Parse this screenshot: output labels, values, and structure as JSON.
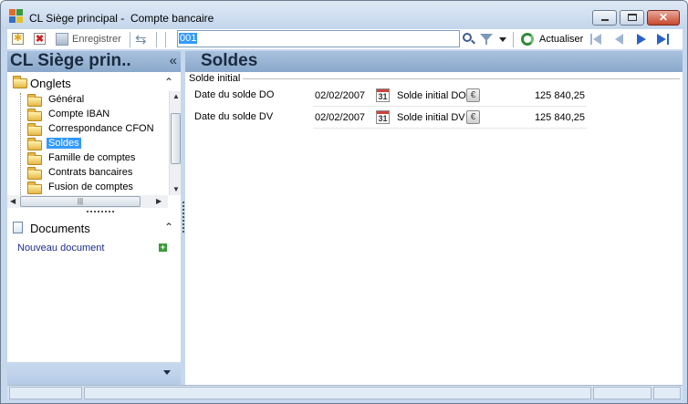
{
  "window": {
    "title": "CL Siège principal -  Compte bancaire"
  },
  "toolbar": {
    "save_label": "Enregistrer",
    "search_value": "001",
    "refresh_label": "Actualiser"
  },
  "sidebar": {
    "title": "CL Siège prin..",
    "collapse_glyph": "«",
    "onglets_header": "Onglets",
    "tree_items": [
      {
        "label": "Général",
        "selected": false
      },
      {
        "label": "Compte IBAN",
        "selected": false
      },
      {
        "label": "Correspondance CFON",
        "selected": false
      },
      {
        "label": "Soldes",
        "selected": true
      },
      {
        "label": "Famille de comptes",
        "selected": false
      },
      {
        "label": "Contrats bancaires",
        "selected": false
      },
      {
        "label": "Fusion de comptes",
        "selected": false
      }
    ],
    "documents_header": "Documents",
    "new_document_link": "Nouveau document"
  },
  "main": {
    "title": "Soldes",
    "group_label": "Solde initial",
    "rows": [
      {
        "label": "Date du solde DO",
        "date": "02/02/2007",
        "amount_label": "Solde initial DO",
        "amount": "125 840,25"
      },
      {
        "label": "Date du solde DV",
        "date": "02/02/2007",
        "amount_label": "Solde initial DV",
        "amount": "125 840,25"
      }
    ]
  },
  "icons": {
    "calendar_day": "31",
    "euro": "€"
  },
  "colors": {
    "selection": "#3399ff",
    "header_band": "#a8c1dd",
    "link": "#1f2f8a"
  }
}
